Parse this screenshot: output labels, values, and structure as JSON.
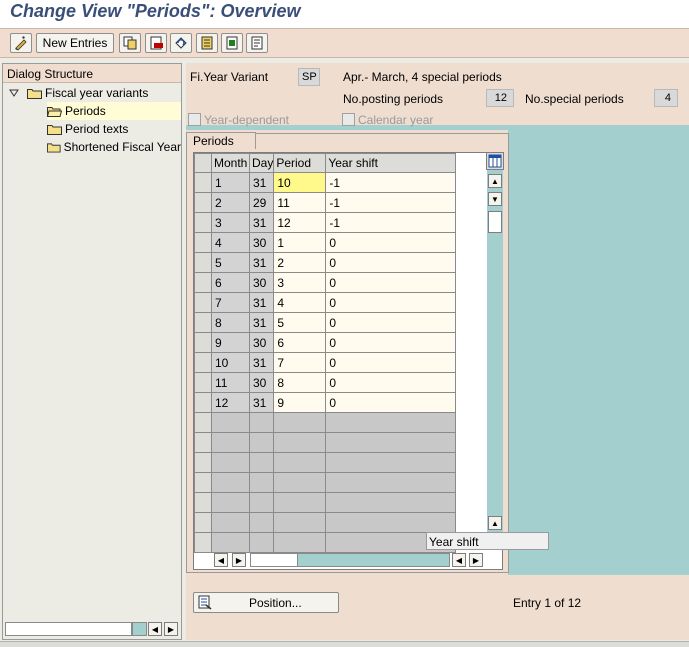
{
  "title": "Change View \"Periods\": Overview",
  "toolbar": {
    "new_entries": "New Entries",
    "icons": [
      "edit-pencil-icon",
      "copy-icon",
      "delete-icon",
      "undo-icon",
      "select-all-icon",
      "select-block-icon",
      "deselect-all-icon"
    ]
  },
  "dialog": {
    "header": "Dialog Structure",
    "tree": [
      {
        "label": "Fiscal year variants",
        "level": 0,
        "expanded": true
      },
      {
        "label": "Periods",
        "level": 1,
        "selected": true
      },
      {
        "label": "Period texts",
        "level": 1
      },
      {
        "label": "Shortened Fiscal Year",
        "level": 1
      }
    ]
  },
  "header_fields": {
    "variant_label": "Fi.Year Variant",
    "variant_value": "SP",
    "variant_desc": "Apr.- March, 4 special periods",
    "posting_label": "No.posting periods",
    "posting_value": "12",
    "special_label": "No.special periods",
    "special_value": "4",
    "year_dependent_label": "Year-dependent",
    "calendar_year_label": "Calendar year"
  },
  "periods": {
    "tab_label": "Periods",
    "columns": [
      "Month",
      "Day",
      "Period",
      "Year shift"
    ],
    "rows": [
      [
        "1",
        "31",
        "10",
        "-1"
      ],
      [
        "2",
        "29",
        "11",
        "-1"
      ],
      [
        "3",
        "31",
        "12",
        "-1"
      ],
      [
        "4",
        "30",
        "1",
        "0"
      ],
      [
        "5",
        "31",
        "2",
        "0"
      ],
      [
        "6",
        "30",
        "3",
        "0"
      ],
      [
        "7",
        "31",
        "4",
        "0"
      ],
      [
        "8",
        "31",
        "5",
        "0"
      ],
      [
        "9",
        "30",
        "6",
        "0"
      ],
      [
        "10",
        "31",
        "7",
        "0"
      ],
      [
        "11",
        "30",
        "8",
        "0"
      ],
      [
        "12",
        "31",
        "9",
        "0"
      ]
    ],
    "empty_rows": 7,
    "tooltip": "Year shift"
  },
  "footer": {
    "position_button": "Position...",
    "entry_text": "Entry 1 of 12"
  },
  "colors": {
    "title": "#3a4f78",
    "toolbar_bg": "#f0ddcf",
    "panel_teal": "#a4cfcf",
    "focus_cell": "#fff98c"
  }
}
